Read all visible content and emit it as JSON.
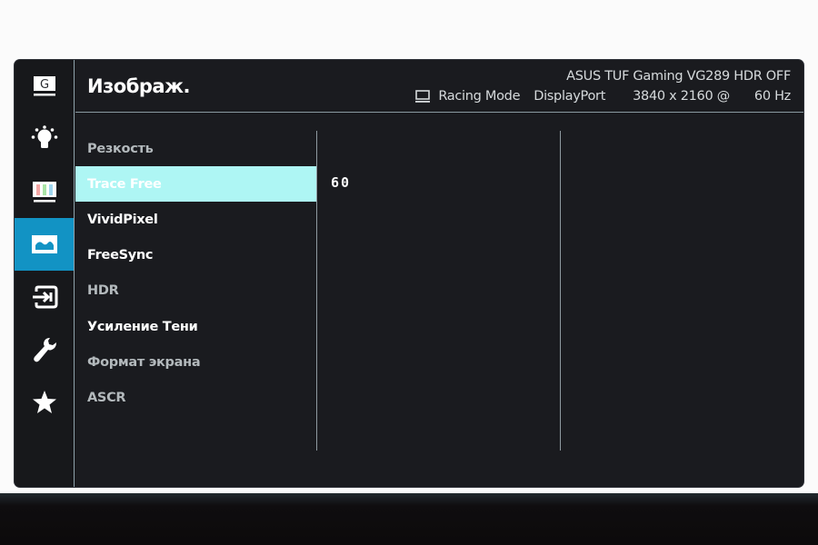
{
  "header": {
    "title": "Изображ.",
    "model": "ASUS TUF Gaming VG289 HDR OFF",
    "mode_icon": "monitor-icon",
    "mode": "Racing Mode",
    "input": "DisplayPort",
    "resolution": "3840 x 2160 @",
    "refresh": "60 Hz"
  },
  "sidebar": {
    "items": [
      {
        "id": "gameplus",
        "icon": "gameplus-icon",
        "active": false
      },
      {
        "id": "splendid",
        "icon": "lightbulb-icon",
        "active": false
      },
      {
        "id": "color",
        "icon": "color-icon",
        "active": false
      },
      {
        "id": "image",
        "icon": "image-icon",
        "active": true
      },
      {
        "id": "input-select",
        "icon": "input-icon",
        "active": false
      },
      {
        "id": "system-setup",
        "icon": "wrench-icon",
        "active": false
      },
      {
        "id": "myfavorite",
        "icon": "star-icon",
        "active": false
      }
    ]
  },
  "menu": {
    "items": [
      {
        "label": "Резкость",
        "state": "dim"
      },
      {
        "label": "Trace Free",
        "state": "selected"
      },
      {
        "label": "VividPixel",
        "state": "normal"
      },
      {
        "label": "FreeSync",
        "state": "normal"
      },
      {
        "label": "HDR",
        "state": "dim"
      },
      {
        "label": "Усиление Тени",
        "state": "normal"
      },
      {
        "label": "Формат экрана",
        "state": "dim"
      },
      {
        "label": "ASCR",
        "state": "dim"
      }
    ]
  },
  "value_panel": {
    "value": "60"
  },
  "colors": {
    "accent": "#1293c4",
    "selected": "#aef6f4",
    "background": "#1a1b1f"
  }
}
